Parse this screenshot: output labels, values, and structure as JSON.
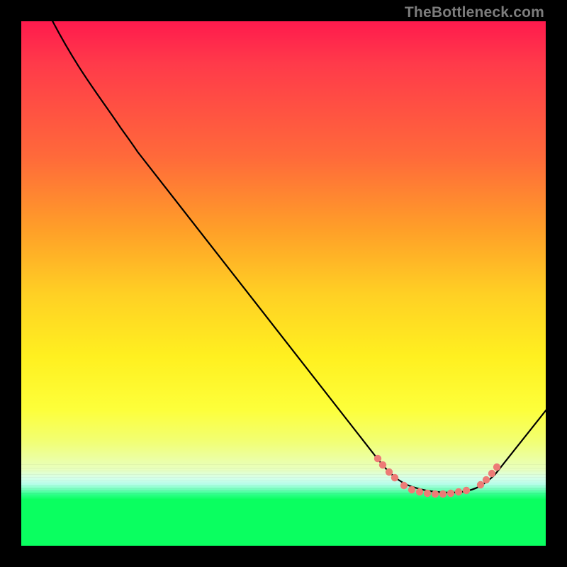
{
  "watermark": "TheBottleneck.com",
  "chart_data": {
    "type": "line",
    "title": "",
    "xlabel": "",
    "ylabel": "",
    "xlim": [
      0,
      100
    ],
    "ylim": [
      0,
      100
    ],
    "series": [
      {
        "name": "curve",
        "x": [
          5,
          10,
          15,
          19,
          22,
          30,
          40,
          50,
          60,
          68,
          72,
          75,
          78,
          80,
          82,
          84,
          86,
          88,
          90,
          93,
          96,
          100
        ],
        "y": [
          102,
          94,
          88,
          82,
          78,
          68,
          56,
          43,
          30,
          20,
          15,
          13,
          11.5,
          10.7,
          10.2,
          9.9,
          9.8,
          9.9,
          10.4,
          12,
          17,
          26
        ]
      }
    ],
    "markers": {
      "name": "bottleneck-range-dots",
      "color": "#ed7b76",
      "x": [
        68,
        69,
        70.2,
        71.3,
        73,
        74.5,
        76,
        77.5,
        79,
        80.5,
        82,
        83.5,
        85,
        87.6,
        88.7,
        89.8,
        90.7
      ],
      "y": [
        16.6,
        15.4,
        14.1,
        13,
        11.5,
        10.7,
        10.3,
        10,
        9.9,
        9.9,
        10,
        10.3,
        10.5,
        11.6,
        12.6,
        13.8,
        15
      ]
    },
    "background_gradient_stops": [
      {
        "pos": 0.0,
        "color": "#ff1a4d"
      },
      {
        "pos": 0.26,
        "color": "#ff6a3a"
      },
      {
        "pos": 0.52,
        "color": "#ffd024"
      },
      {
        "pos": 0.74,
        "color": "#fdff3a"
      },
      {
        "pos": 0.86,
        "color": "#e8ffc0"
      },
      {
        "pos": 0.91,
        "color": "#0aff60"
      },
      {
        "pos": 1.0,
        "color": "#0aff60"
      }
    ],
    "frame_color": "#000000"
  }
}
